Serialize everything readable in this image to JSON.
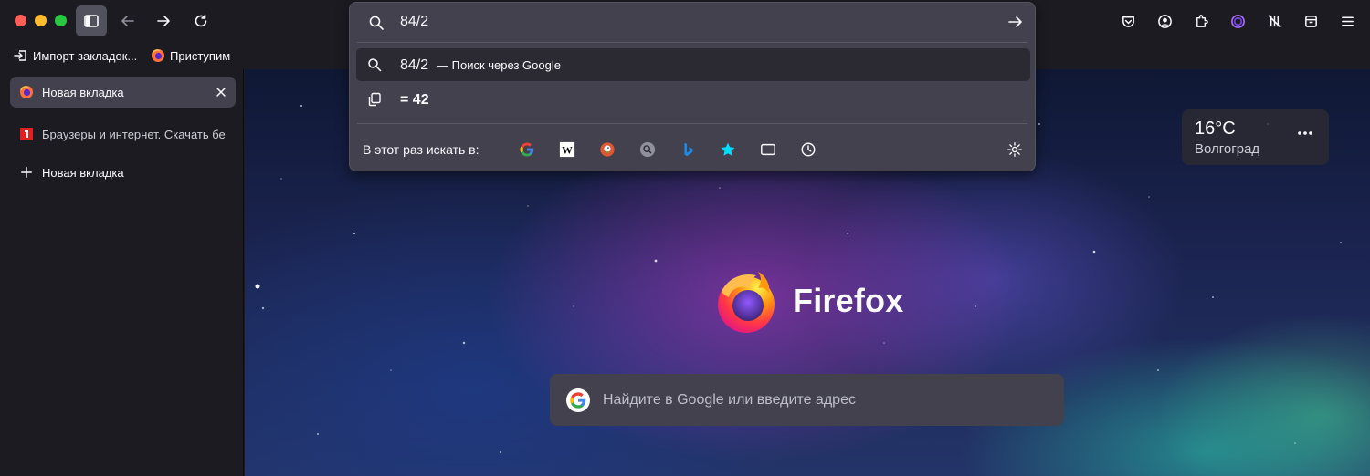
{
  "window": {
    "traffic_lights": [
      "close",
      "minimize",
      "zoom"
    ]
  },
  "toolbar": {
    "left_icons": [
      "sidebar-toggle-icon",
      "back-arrow-icon",
      "forward-arrow-icon",
      "reload-icon"
    ],
    "right_icons": [
      "pocket-icon",
      "account-icon",
      "extensions-icon",
      "private-icon",
      "no-tracking-icon",
      "library-icon",
      "menu-icon"
    ]
  },
  "bookmarks": [
    {
      "label": "Импорт закладок...",
      "icon": "import-icon"
    },
    {
      "label": "Приступим",
      "icon": "firefox-icon"
    }
  ],
  "tabs": [
    {
      "title": "Новая вкладка",
      "icon": "firefox-icon",
      "selected": true
    },
    {
      "title": "Браузеры и интернет. Скачать бе",
      "icon": "site-red-icon",
      "selected": false
    },
    {
      "title": "Новая вкладка",
      "icon": "plus-icon",
      "selected": false
    }
  ],
  "urlbar": {
    "query": "84/2",
    "suggestions": [
      {
        "main": "84/2",
        "sub": "— Поиск через Google",
        "icon": "search-icon"
      },
      {
        "main": "= 42",
        "sub": "",
        "icon": "copy-icon"
      }
    ],
    "engines_label": "В этот раз искать в:",
    "engines": [
      "google",
      "wikipedia",
      "duckduckgo",
      "search-magnifier",
      "bing",
      "bookmarks-star",
      "tabs",
      "history"
    ]
  },
  "weather": {
    "temp": "16°C",
    "city": "Волгоград"
  },
  "brand": {
    "name": "Firefox"
  },
  "search": {
    "placeholder": "Найдите в Google или введите адрес"
  },
  "colors": {
    "chrome_bg": "#1c1b22",
    "panel_bg": "#42414d",
    "highlight": "#2b2a33",
    "text": "#fbfbfe"
  }
}
